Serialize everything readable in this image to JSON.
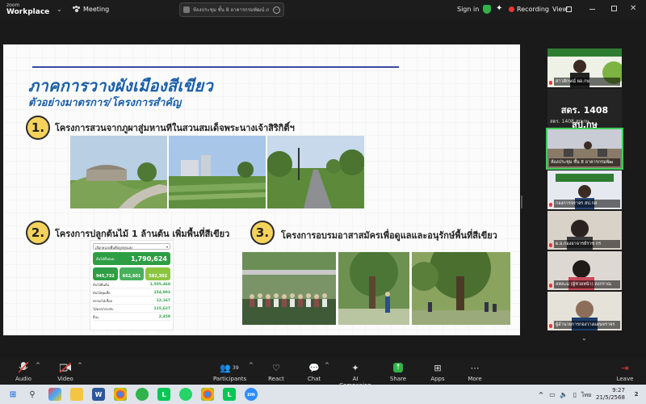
{
  "app": {
    "logo_line1": "zoom",
    "logo_line2": "Workplace",
    "meeting_label": "Meeting",
    "meeting_title": "ห้องประชุม ชั้น 8 อาคารกรมพัฒน์ ภ"
  },
  "topbar": {
    "sign_in": "Sign in",
    "recording": "Recording",
    "view": "View"
  },
  "slide": {
    "title": "ภาคการวางผังเมืองสีเขียว",
    "subtitle": "ตัวอย่างมาตรการ/โครงการสำคัญ",
    "projects": [
      {
        "num": "1.",
        "label": "โครงการสวนจากภูผาสู่มหานทีในสวนสมเด็จพระนางเจ้าสิริกิติ์ฯ"
      },
      {
        "num": "2.",
        "label": "โครงการปลูกต้นไม้ 1 ล้านต้น เพิ่มพื้นที่สีเขียว"
      },
      {
        "num": "3.",
        "label": "โครงการอบรมอาสาสมัครเพื่อดูแลและอนุรักษ์พื้นที่สีเขียว"
      }
    ],
    "dashboard": {
      "select": "เลือกหน่วยพื้นที่ปลูกทุกแห่ง",
      "total_label": "ต้นไม้ทั้งหมด",
      "total": "1,790,624",
      "a": "945,732",
      "b": "662,601",
      "c": "582,302",
      "rows": [
        {
          "label": "ต้นไม้ยืนต้น",
          "value": "1,505,468"
        },
        {
          "label": "ต้นไม้พุ่มเตี้ย",
          "value": "154,903"
        },
        {
          "label": "พรรณไม้เลื้อย",
          "value": "12,167"
        },
        {
          "label": "ไม้ดอก/ประดับ",
          "value": "115,627"
        },
        {
          "label": "อื่นๆ",
          "value": "2,459"
        }
      ]
    }
  },
  "participants": {
    "tiles": [
      {
        "name": "สาวลักษณ์ ผอ.กษ"
      },
      {
        "name": "ห้องประชุม ชั้น 8 อาคารกรมพัฒ"
      },
      {
        "name": "กองการจราจร สป.กส"
      },
      {
        "name": "ผ.อ.กองอาจารย์ราช กร"
      },
      {
        "name": "ลหละม (ผู้ช่วยหน้า) สงกราณ"
      },
      {
        "name": "ผู้อำนวยการกองวางแผนจราจร"
      }
    ],
    "name_tile_big": "สดร. 1408 สป.กษ",
    "name_tile_small": "สดร. 1408 สป.กษ"
  },
  "toolbar": {
    "audio": "Audio",
    "video": "Video",
    "participants": "Participants",
    "participants_count": "39",
    "react": "React",
    "chat": "Chat",
    "ai": "AI Companion",
    "share": "Share",
    "apps": "Apps",
    "more": "More",
    "leave": "Leave"
  },
  "taskbar": {
    "lang": "ไทย",
    "time": "9:27",
    "date": "21/5/2568",
    "zoom_label": "zm",
    "notif_count": "2"
  },
  "colors": {
    "accent_green": "#2e9e45",
    "title_blue": "#1a5fa8",
    "record_red": "#e53935"
  }
}
